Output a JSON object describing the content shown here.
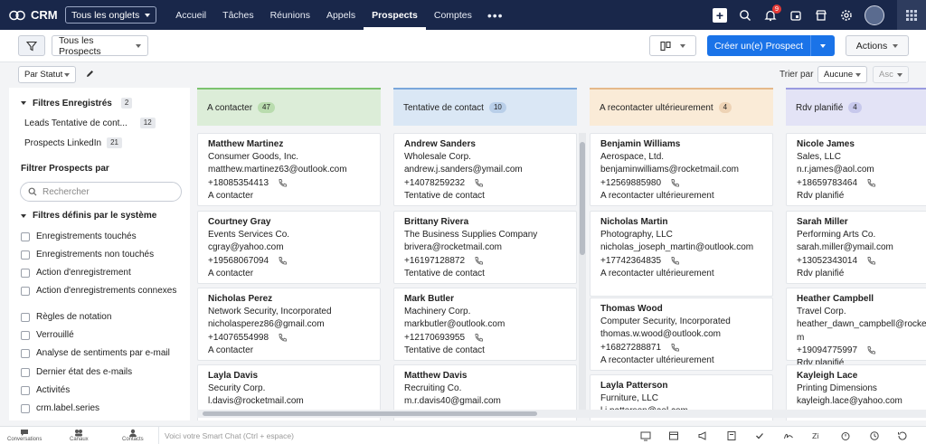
{
  "app": {
    "name": "CRM",
    "tabs_dropdown": "Tous les onglets"
  },
  "nav": [
    {
      "label": "Accueil",
      "active": false
    },
    {
      "label": "Tâches",
      "active": false
    },
    {
      "label": "Réunions",
      "active": false
    },
    {
      "label": "Appels",
      "active": false
    },
    {
      "label": "Prospects",
      "active": true
    },
    {
      "label": "Comptes",
      "active": false
    }
  ],
  "nav_icons": [
    "plus-icon",
    "search-icon",
    "bell-icon",
    "calendar-icon",
    "store-icon",
    "gear-icon"
  ],
  "notifications_count": "9",
  "toolbar": {
    "view_label": "Tous les Prospects",
    "create_label": "Créer un(e) Prospect",
    "actions_label": "Actions"
  },
  "subbar": {
    "group_by": "Par Statut",
    "sort_label": "Trier par",
    "sort_value": "Aucune",
    "sort_dir": "Asc"
  },
  "sidebar": {
    "saved_title": "Filtres Enregistrés",
    "saved_count": "2",
    "saved_filters": [
      {
        "label": "Leads Tentative de cont...",
        "count": "12"
      },
      {
        "label": "Prospects LinkedIn",
        "count": "21"
      }
    ],
    "filter_title": "Filtrer Prospects par",
    "search_placeholder": "Rechercher",
    "system_title": "Filtres définis par le système",
    "system_filters": [
      "Enregistrements touchés",
      "Enregistrements non touchés",
      "Action d'enregistrement",
      "Action d'enregistrements connexes",
      "Règles de notation",
      "Verrouillé",
      "Analyse de sentiments par e-mail",
      "Dernier état des e-mails",
      "Activités",
      "crm.label.series"
    ]
  },
  "columns": [
    {
      "title": "A contacter",
      "count": "47",
      "color": "#dcedd8",
      "border": "#7cc36f",
      "countbg": "#b9dcae",
      "cards": [
        {
          "name": "Matthew Martinez",
          "company": "Consumer Goods, Inc.",
          "email": "matthew.martinez63@outlook.com",
          "phone": "+18085354413",
          "status": "A contacter"
        },
        {
          "name": "Courtney Gray",
          "company": "Events Services Co.",
          "email": "cgray@yahoo.com",
          "phone": "+19568067094",
          "status": "A contacter"
        },
        {
          "name": "Nicholas Perez",
          "company": "Network Security, Incorporated",
          "email": "nicholasperez86@gmail.com",
          "phone": "+14076554998",
          "status": "A contacter"
        },
        {
          "name": "Layla Davis",
          "company": "Security Corp.",
          "email": "l.davis@rocketmail.com",
          "phone": "",
          "status": ""
        }
      ]
    },
    {
      "title": "Tentative de contact",
      "count": "10",
      "color": "#dae7f5",
      "border": "#7aa7db",
      "countbg": "#b9cfe9",
      "cards": [
        {
          "name": "Andrew Sanders",
          "company": "Wholesale Corp.",
          "email": "andrew.j.sanders@ymail.com",
          "phone": "+14078259232",
          "status": "Tentative de contact"
        },
        {
          "name": "Brittany Rivera",
          "company": "The Business Supplies Company",
          "email": "brivera@rocketmail.com",
          "phone": "+16197128872",
          "status": "Tentative de contact"
        },
        {
          "name": "Mark Butler",
          "company": "Machinery Corp.",
          "email": "markbutler@outlook.com",
          "phone": "+12170693955",
          "status": "Tentative de contact"
        },
        {
          "name": "Matthew Davis",
          "company": "Recruiting Co.",
          "email": "m.r.davis40@gmail.com",
          "phone": "",
          "status": ""
        }
      ]
    },
    {
      "title": "A recontacter ultérieurement",
      "count": "4",
      "color": "#faebd7",
      "border": "#e5b98a",
      "countbg": "#eed3b5",
      "cards": [
        {
          "name": "Benjamin Williams",
          "company": "Aerospace, Ltd.",
          "email": "benjaminwilliams@rocketmail.com",
          "phone": "+12569885980",
          "status": "A recontacter ultérieurement"
        },
        {
          "name": "Nicholas Martin",
          "company": "Photography, LLC",
          "email": "nicholas_joseph_martin@outlook.com",
          "phone": "+17742364835",
          "status": "A recontacter ultérieurement"
        },
        {
          "name": "Thomas Wood",
          "company": "Computer Security, Incorporated",
          "email": "thomas.w.wood@outlook.com",
          "phone": "+16827288871",
          "status": "A recontacter ultérieurement"
        },
        {
          "name": "Layla Patterson",
          "company": "Furniture, LLC",
          "email": "l.i.patterson@aol.com",
          "phone": "",
          "status": ""
        }
      ]
    },
    {
      "title": "Rdv planifié",
      "count": "4",
      "color": "#e3e3f6",
      "border": "#9a9be0",
      "countbg": "#c7c8ec",
      "cards": [
        {
          "name": "Nicole James",
          "company": "Sales, LLC",
          "email": "n.r.james@aol.com",
          "phone": "+18659783464",
          "status": "Rdv planifié"
        },
        {
          "name": "Sarah Miller",
          "company": "Performing Arts Co.",
          "email": "sarah.miller@ymail.com",
          "phone": "+13052343014",
          "status": "Rdv planifié"
        },
        {
          "name": "Heather Campbell",
          "company": "Travel Corp.",
          "email": "heather_dawn_campbell@rocketmail.com",
          "phone": "+19094775997",
          "status": "Rdv planifié"
        },
        {
          "name": "Kayleigh Lace",
          "company": "Printing Dimensions",
          "email": "kayleigh.lace@yahoo.com",
          "phone": "",
          "status": ""
        }
      ]
    }
  ],
  "bottom": {
    "items": [
      "Conversations",
      "Canaux",
      "Contacts"
    ],
    "chat_placeholder": "Voici votre Smart Chat (Ctrl + espace)"
  }
}
